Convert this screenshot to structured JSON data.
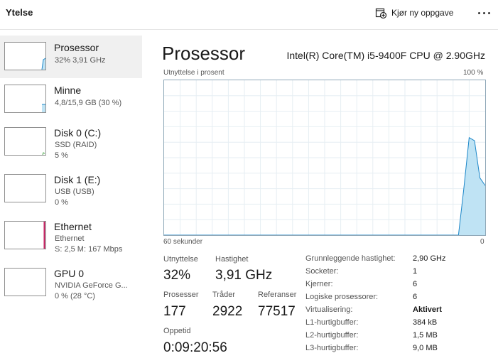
{
  "header": {
    "title": "Ytelse",
    "new_task_label": "Kjør ny oppgave",
    "more_icon": "more-dots-icon",
    "new_task_icon": "new-task-icon"
  },
  "sidebar": {
    "items": [
      {
        "name": "Prosessor",
        "sub1": "32% 3,91 GHz",
        "color": "#1a86c8",
        "selected": true
      },
      {
        "name": "Minne",
        "sub1": "4,8/15,9 GB (30 %)",
        "color": "#1a86c8"
      },
      {
        "name": "Disk 0 (C:)",
        "sub1": "SSD (RAID)",
        "sub2": "5 %",
        "color": "#4ca64c"
      },
      {
        "name": "Disk 1 (E:)",
        "sub1": "USB (USB)",
        "sub2": "0 %",
        "color": "#4ca64c"
      },
      {
        "name": "Ethernet",
        "sub1": "Ethernet",
        "sub2": "S: 2,5 M: 167 Mbps",
        "color": "#c2185b"
      },
      {
        "name": "GPU 0",
        "sub1": "NVIDIA GeForce G...",
        "sub2": "0 % (28 °C)",
        "color": "#1a86c8"
      }
    ]
  },
  "main": {
    "title": "Prosessor",
    "cpu_name": "Intel(R) Core(TM) i5-9400F CPU @ 2.90GHz",
    "graph": {
      "top_left": "Utnyttelse i prosent",
      "top_right": "100 %",
      "bottom_left": "60 sekunder",
      "bottom_right": "0"
    },
    "stats": {
      "util_label": "Utnyttelse",
      "util_value": "32%",
      "speed_label": "Hastighet",
      "speed_value": "3,91 GHz",
      "proc_label": "Prosesser",
      "proc_value": "177",
      "threads_label": "Tråder",
      "threads_value": "2922",
      "refs_label": "Referanser",
      "refs_value": "77517",
      "uptime_label": "Oppetid",
      "uptime_value": "0:09:20:56"
    },
    "info": [
      {
        "k": "Grunnleggende hastighet:",
        "v": "2,90 GHz"
      },
      {
        "k": "Socketer:",
        "v": "1"
      },
      {
        "k": "Kjerner:",
        "v": "6"
      },
      {
        "k": "Logiske prosessorer:",
        "v": "6"
      },
      {
        "k": "Virtualisering:",
        "v": "Aktivert",
        "bold": true
      },
      {
        "k": "L1-hurtigbuffer:",
        "v": "384 kB"
      },
      {
        "k": "L2-hurtigbuffer:",
        "v": "1,5 MB"
      },
      {
        "k": "L3-hurtigbuffer:",
        "v": "9,0 MB"
      }
    ]
  },
  "chart_data": {
    "type": "area",
    "x": [
      60,
      57,
      54,
      51,
      48,
      45,
      42,
      39,
      36,
      33,
      30,
      27,
      24,
      21,
      18,
      15,
      12,
      9,
      6,
      5,
      4,
      3,
      2,
      1,
      0
    ],
    "values": [
      0,
      0,
      0,
      0,
      0,
      0,
      0,
      0,
      0,
      0,
      0,
      0,
      0,
      0,
      0,
      0,
      0,
      0,
      0,
      0,
      30,
      63,
      61,
      37,
      32
    ],
    "xlim": [
      60,
      0
    ],
    "ylim": [
      0,
      100
    ],
    "xlabel": "60 sekunder",
    "ylabel": "Utnyttelse i prosent",
    "grid": true,
    "fill_color": "#bfe3f4",
    "line_color": "#1a86c8"
  }
}
